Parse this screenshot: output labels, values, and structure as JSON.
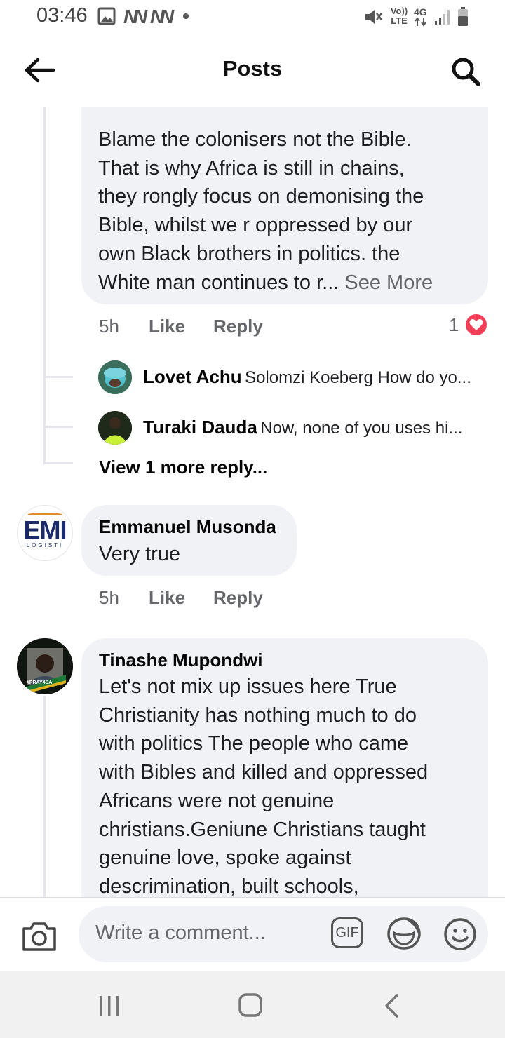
{
  "status_bar": {
    "time": "03:46",
    "network": "4G",
    "volte": "Vo)) LTE"
  },
  "header": {
    "title": "Posts",
    "back_icon": "back-arrow-icon",
    "search_icon": "search-icon"
  },
  "thread": {
    "comment": {
      "text_lines": [
        "Blame the colonisers not the Bible.",
        "That is why Africa is still in chains,",
        "they rongly  focus on demonising the",
        "Bible, whilst we r oppressed by our",
        "own Black brothers in politics. the"
      ],
      "last_line": "White man continues to r...",
      "see_more": "See More",
      "time": "5h",
      "like": "Like",
      "reply": "Reply",
      "reaction_count": "1"
    },
    "replies": [
      {
        "name": "Lovet Achu",
        "snippet": "Solomzi Koeberg How do yo..."
      },
      {
        "name": "Turaki Dauda",
        "snippet": "Now, none of you uses hi..."
      }
    ],
    "view_more": "View 1 more reply..."
  },
  "comment2": {
    "author": "Emmanuel Musonda",
    "text": "Very true",
    "avatar_logo": "EMI",
    "avatar_sub": "LOGISTI",
    "time": "5h",
    "like": "Like",
    "reply": "Reply"
  },
  "comment3": {
    "author": "Tinashe Mupondwi",
    "avatar_tag": "#PRAY4SA",
    "text_lines": [
      "Let's not mix up issues here True",
      "Christianity has nothing much to do",
      "with politics The people who came",
      "with Bibles and killed and oppressed",
      "Africans were not genuine",
      "christians.Geniune Christians taught",
      "genuine love, spoke against",
      "descrimination, built schools,"
    ]
  },
  "composer": {
    "placeholder": "Write a comment...",
    "gif_label": "GIF"
  },
  "colors": {
    "bubble": "#f0f2f5",
    "love_red": "#f33e58",
    "meta_gray": "#65676b"
  }
}
